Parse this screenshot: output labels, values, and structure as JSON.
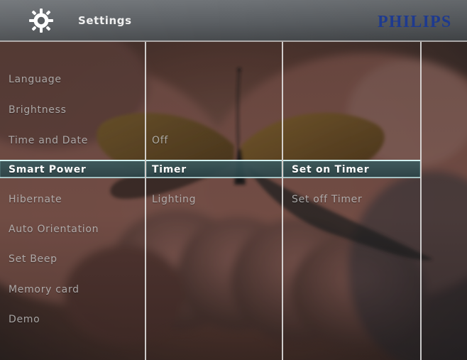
{
  "header": {
    "title": "Settings",
    "brand": "PHILIPS",
    "icon": "gear-icon"
  },
  "columns": {
    "main": {
      "items": [
        {
          "label": "Language"
        },
        {
          "label": "Brightness"
        },
        {
          "label": "Time and Date"
        },
        {
          "label": "Smart Power",
          "selected": true
        },
        {
          "label": "Hibernate"
        },
        {
          "label": "Auto Orientation"
        },
        {
          "label": "Set Beep"
        },
        {
          "label": "Memory card"
        },
        {
          "label": "Demo"
        }
      ]
    },
    "smart_power": {
      "items": [
        {
          "label": "Off"
        },
        {
          "label": "Timer",
          "selected": true
        },
        {
          "label": "Lighting"
        }
      ]
    },
    "timer": {
      "items": [
        {
          "label": "Set on Timer",
          "selected": true
        },
        {
          "label": "Set off Timer"
        }
      ]
    }
  },
  "colors": {
    "highlight": "#3d5c60",
    "highlight_edge": "#dfffff",
    "brand": "#1e3a8f"
  }
}
